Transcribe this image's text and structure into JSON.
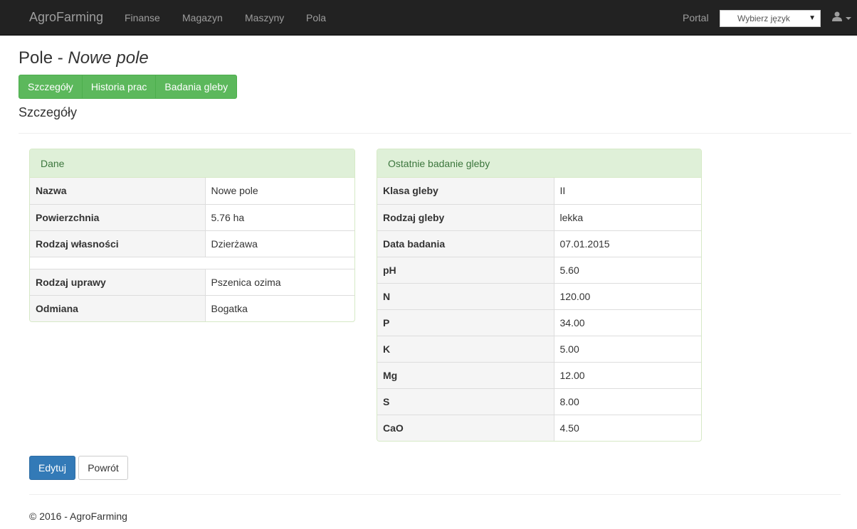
{
  "navbar": {
    "brand": "AgroFarming",
    "links": [
      "Finanse",
      "Magazyn",
      "Maszyny",
      "Pola"
    ],
    "portal": "Portal",
    "language_select": "Wybierz język",
    "user_icon": "user-icon"
  },
  "page": {
    "title_prefix": "Pole - ",
    "title_name": "Nowe pole",
    "tabs": [
      "Szczegóły",
      "Historia prac",
      "Badania gleby"
    ],
    "section_title": "Szczegóły"
  },
  "details_panel": {
    "heading": "Dane",
    "rows": [
      {
        "label": "Nazwa",
        "value": "Nowe pole"
      },
      {
        "label": "Powierzchnia",
        "value": "5.76 ha"
      },
      {
        "label": "Rodzaj własności",
        "value": "Dzierżawa"
      }
    ],
    "rows2": [
      {
        "label": "Rodzaj uprawy",
        "value": "Pszenica ozima"
      },
      {
        "label": "Odmiana",
        "value": "Bogatka"
      }
    ]
  },
  "soil_panel": {
    "heading": "Ostatnie badanie gleby",
    "rows": [
      {
        "label": "Klasa gleby",
        "value": "II"
      },
      {
        "label": "Rodzaj gleby",
        "value": "lekka"
      },
      {
        "label": "Data badania",
        "value": "07.01.2015"
      },
      {
        "label": "pH",
        "value": "5.60"
      },
      {
        "label": "N",
        "value": "120.00"
      },
      {
        "label": "P",
        "value": "34.00"
      },
      {
        "label": "K",
        "value": "5.00"
      },
      {
        "label": "Mg",
        "value": "12.00"
      },
      {
        "label": "S",
        "value": "8.00"
      },
      {
        "label": "CaO",
        "value": "4.50"
      }
    ]
  },
  "actions": {
    "edit": "Edytuj",
    "back": "Powrót"
  },
  "footer": {
    "text": "© 2016 - AgroFarming"
  }
}
